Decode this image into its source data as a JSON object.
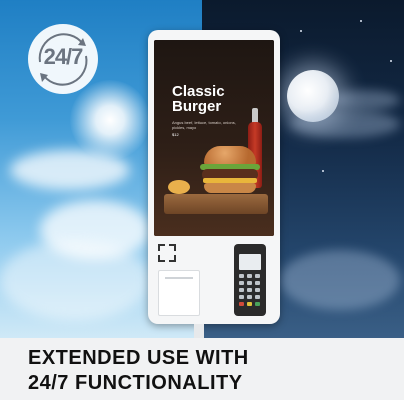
{
  "badge": {
    "text": "24/7",
    "icon": "clock-cycle-icon"
  },
  "kiosk": {
    "menu_title_line1": "Classic",
    "menu_title_line2": "Burger",
    "menu_description": "Angus beef, lettuce, tomato, onions, pickles, mayo",
    "menu_price": "$12",
    "scanner_icon": "qr-scanner-icon",
    "payment_terminal": "card-terminal"
  },
  "caption": {
    "line1": "EXTENDED USE WITH",
    "line2": "24/7 FUNCTIONALITY"
  },
  "colors": {
    "day_sky": "#3f9ad6",
    "night_sky": "#132a47",
    "caption_bg": "#f1f2f3"
  }
}
